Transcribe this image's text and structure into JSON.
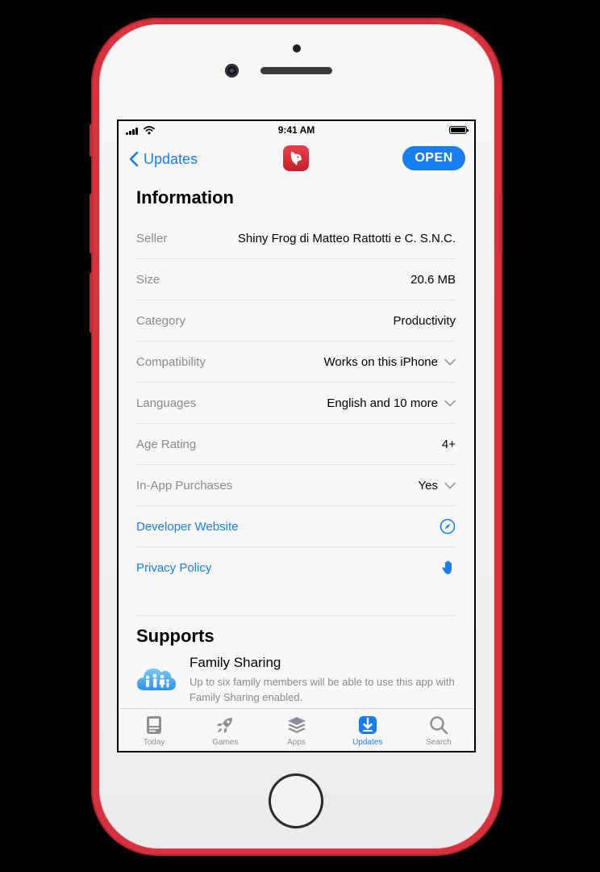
{
  "status_bar": {
    "time": "9:41 AM"
  },
  "nav": {
    "back_label": "Updates",
    "open_label": "OPEN"
  },
  "information": {
    "title": "Information",
    "rows": [
      {
        "label": "Seller",
        "value": "Shiny Frog di Matteo Rattotti e C. S.N.C."
      },
      {
        "label": "Size",
        "value": "20.6 MB"
      },
      {
        "label": "Category",
        "value": "Productivity"
      },
      {
        "label": "Compatibility",
        "value": "Works on this iPhone"
      },
      {
        "label": "Languages",
        "value": "English and 10 more"
      },
      {
        "label": "Age Rating",
        "value": "4+"
      },
      {
        "label": "In-App Purchases",
        "value": "Yes"
      }
    ],
    "links": [
      {
        "label": "Developer Website",
        "icon": "compass-icon"
      },
      {
        "label": "Privacy Policy",
        "icon": "hand-icon"
      }
    ]
  },
  "supports": {
    "title": "Supports",
    "items": [
      {
        "name": "Family Sharing",
        "description": "Up to six family members will be able to use this app with Family Sharing enabled.",
        "icon": "family-sharing-icon"
      }
    ]
  },
  "tab_bar": {
    "tabs": [
      {
        "label": "Today",
        "icon": "today-icon",
        "active": false
      },
      {
        "label": "Games",
        "icon": "rocket-icon",
        "active": false
      },
      {
        "label": "Apps",
        "icon": "apps-stack-icon",
        "active": false
      },
      {
        "label": "Updates",
        "icon": "updates-download-icon",
        "active": true
      },
      {
        "label": "Search",
        "icon": "search-icon",
        "active": false
      }
    ]
  },
  "colors": {
    "accent": "#1a7ef3",
    "device_red": "#d8323f",
    "secondary_text": "#8a8a8e"
  }
}
